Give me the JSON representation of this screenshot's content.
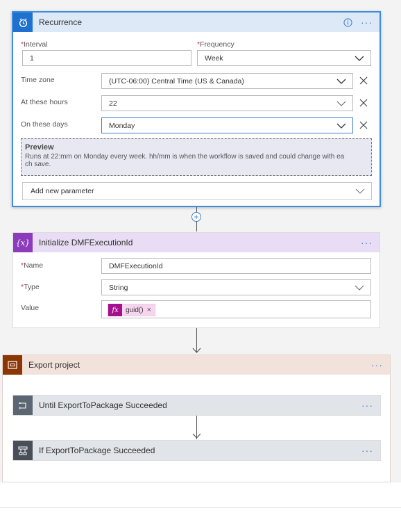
{
  "colors": {
    "recurrence_header": "#dde9f7",
    "recurrence_icon": "#1f71cf",
    "variable_header": "#e9ddf6",
    "variable_icon": "#8c3bbc",
    "scope_header": "#f1e3dc",
    "scope_icon": "#8b3603",
    "control_header": "#e1e4e8",
    "until_icon": "#5b6672",
    "condition_icon": "#484f58",
    "accent": "#3f7ec9",
    "expression_token": "#a6108f"
  },
  "recurrence": {
    "title": "Recurrence",
    "icon": "alarm-clock-icon",
    "interval_label": "Interval",
    "interval_value": "1",
    "frequency_label": "Frequency",
    "frequency_value": "Week",
    "timezone_label": "Time zone",
    "timezone_value": "(UTC-06:00) Central Time (US & Canada)",
    "hours_label": "At these hours",
    "hours_value": "22",
    "days_label": "On these days",
    "days_value": "Monday",
    "preview_title": "Preview",
    "preview_line1": "Runs at 22:mm on Monday every week. hh/mm is when the workflow is saved and could change with ea",
    "preview_line2": "ch save.",
    "add_param_label": "Add new parameter"
  },
  "init_variable": {
    "title": "Initialize DMFExecutionId",
    "icon_text": "{x}",
    "name_label": "Name",
    "name_value": "DMFExecutionId",
    "type_label": "Type",
    "type_value": "String",
    "value_label": "Value",
    "token_icon_text": "fx",
    "token_label": "guid()",
    "token_remove": "×"
  },
  "export_scope": {
    "title": "Export project",
    "until": {
      "title": "Until ExportToPackage Succeeded"
    },
    "condition": {
      "title": "If ExportToPackage Succeeded"
    }
  },
  "common": {
    "more_label": "···"
  }
}
